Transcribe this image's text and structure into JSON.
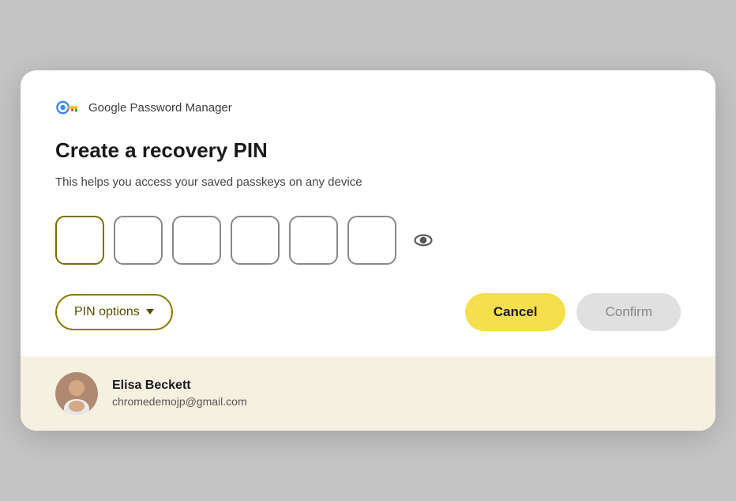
{
  "dialog": {
    "header": {
      "app_name": "Google Password Manager"
    },
    "main_title": "Create a recovery PIN",
    "subtitle": "This helps you access your saved passkeys on any device",
    "pin": {
      "boxes_count": 6,
      "placeholder": ""
    },
    "buttons": {
      "pin_options_label": "PIN options",
      "cancel_label": "Cancel",
      "confirm_label": "Confirm"
    }
  },
  "footer": {
    "user_name": "Elisa Beckett",
    "user_email": "chromedemojp@gmail.com"
  },
  "colors": {
    "pin_border_active": "#8a7b00",
    "cancel_bg": "#f5df4d",
    "confirm_bg": "#e0e0e0",
    "footer_bg": "#f5f0e0"
  }
}
